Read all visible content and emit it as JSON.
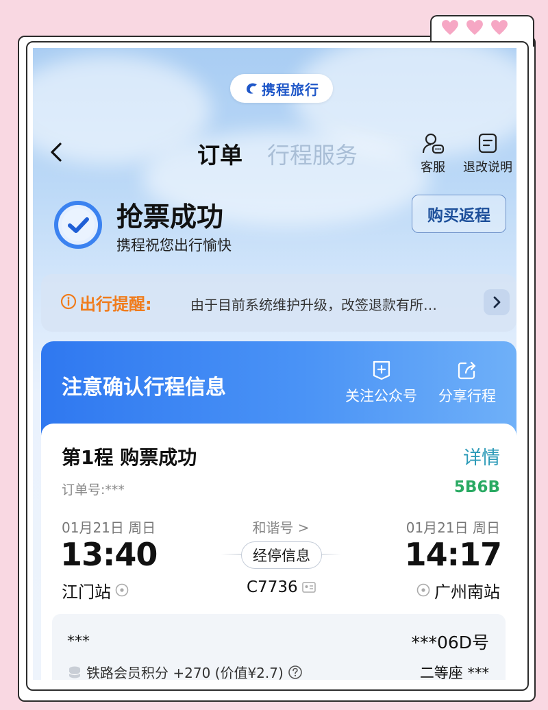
{
  "brand": {
    "logo_text": "携程旅行"
  },
  "header": {
    "tab_active": "订单",
    "tab_inactive": "行程服务",
    "actions": [
      {
        "label": "客服",
        "icon": "customer-service-icon"
      },
      {
        "label": "退改说明",
        "icon": "refund-notes-icon"
      }
    ]
  },
  "status": {
    "title": "抢票成功",
    "subtitle": "携程祝您出行愉快",
    "return_button": "购买返程"
  },
  "notice": {
    "label": "出行提醒:",
    "text": "由于目前系统维护升级，改签退款有所…"
  },
  "confirm": {
    "title": "注意确认行程信息",
    "actions": [
      {
        "label": "关注公众号",
        "icon": "follow-account-icon"
      },
      {
        "label": "分享行程",
        "icon": "share-icon"
      }
    ]
  },
  "segment": {
    "title": "第1程  购票成功",
    "detail_link": "详情",
    "order_label": "订单号:***",
    "order_code": "5B6B",
    "departure": {
      "date": "01月21日 周日",
      "time": "13:40",
      "station": "江门站"
    },
    "arrival": {
      "date": "01月21日 周日",
      "time": "14:17",
      "station": "广州南站"
    },
    "train_type": "和谐号 >",
    "stop_info_button": "经停信息",
    "train_no": "C7736"
  },
  "passenger": {
    "name": "***",
    "seat_no": "***06D号",
    "points_text": "铁路会员积分 +270 (价值¥2.7)",
    "seat_class": "二等座  ***"
  },
  "colors": {
    "brand_blue": "#1f57c8",
    "accent_orange": "#f07c1c",
    "order_green": "#2aaa63",
    "detail_teal": "#2d9bb8",
    "page_pink": "#f9d8e2"
  }
}
